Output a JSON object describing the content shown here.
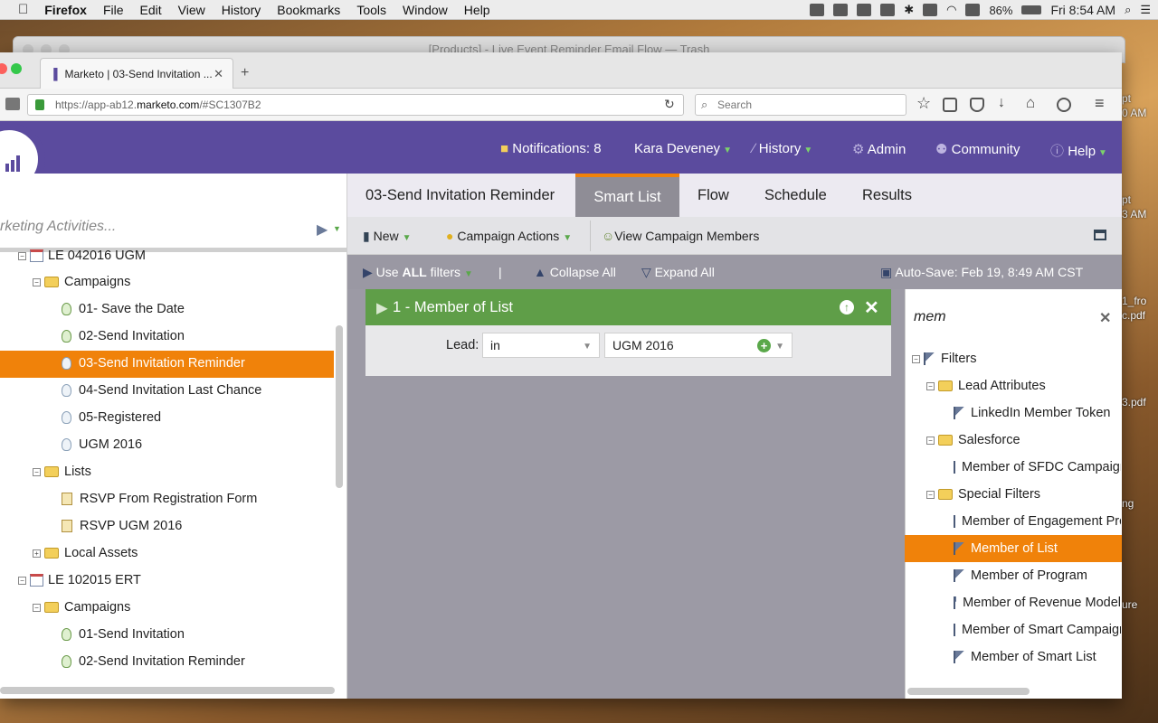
{
  "menubar": {
    "app": "Firefox",
    "items": [
      "File",
      "Edit",
      "View",
      "History",
      "Bookmarks",
      "Tools",
      "Window",
      "Help"
    ],
    "battery": "86%",
    "clock": "Fri 8:54 AM"
  },
  "background_window": {
    "title": "[Products] - Live Event Reminder Email Flow — Trash"
  },
  "browser": {
    "tab_title": "Marketo | 03-Send Invitation ...",
    "url_prefix": "https://app-ab12.",
    "url_host": "marketo.com",
    "url_suffix": "/#SC1307B2",
    "search_placeholder": "Search"
  },
  "header": {
    "notifications": "Notifications: 8",
    "user": "Kara Deveney",
    "history": "History",
    "admin": "Admin",
    "community": "Community",
    "help": "Help"
  },
  "sidebar": {
    "search_placeholder": "rketing Activities...",
    "items": [
      {
        "label": "LE 042016 UGM"
      },
      {
        "label": "Campaigns"
      },
      {
        "label": "01- Save the Date"
      },
      {
        "label": "02-Send Invitation"
      },
      {
        "label": "03-Send Invitation Reminder"
      },
      {
        "label": "04-Send Invitation Last Chance"
      },
      {
        "label": "05-Registered"
      },
      {
        "label": "UGM 2016"
      },
      {
        "label": "Lists"
      },
      {
        "label": "RSVP From Registration Form"
      },
      {
        "label": "RSVP UGM 2016"
      },
      {
        "label": "Local Assets"
      },
      {
        "label": "LE 102015 ERT"
      },
      {
        "label": "Campaigns"
      },
      {
        "label": "01-Send Invitation"
      },
      {
        "label": "02-Send Invitation Reminder"
      }
    ]
  },
  "tabs": {
    "title": "03-Send Invitation Reminder",
    "smart_list": "Smart List",
    "flow": "Flow",
    "schedule": "Schedule",
    "results": "Results"
  },
  "toolbar": {
    "new": "New",
    "campaign_actions": "Campaign Actions",
    "view_members": "View Campaign Members"
  },
  "filterbar": {
    "use_prefix": "Use ",
    "use_all": "ALL",
    "use_suffix": " filters",
    "pipe": "|",
    "collapse": "Collapse All",
    "expand": "Expand All",
    "autosave": "Auto-Save: Feb 19, 8:49 AM CST"
  },
  "filter": {
    "title": "1 - Member of List",
    "lead_label": "Lead:",
    "operator": "in",
    "value": "UGM 2016"
  },
  "rpanel": {
    "search": "mem",
    "items": [
      {
        "label": "Filters"
      },
      {
        "label": "Lead Attributes"
      },
      {
        "label": "LinkedIn Member Token"
      },
      {
        "label": "Salesforce"
      },
      {
        "label": "Member of SFDC Campaign"
      },
      {
        "label": "Special Filters"
      },
      {
        "label": "Member of Engagement Program"
      },
      {
        "label": "Member of List"
      },
      {
        "label": "Member of Program"
      },
      {
        "label": "Member of Revenue Model"
      },
      {
        "label": "Member of Smart Campaign"
      },
      {
        "label": "Member of Smart List"
      }
    ]
  },
  "desktop": {
    "labels": [
      "pt",
      "0 AM",
      "pt",
      "3 AM",
      "1_fro",
      "c.pdf",
      "3.pdf",
      "ng",
      "ure"
    ]
  }
}
